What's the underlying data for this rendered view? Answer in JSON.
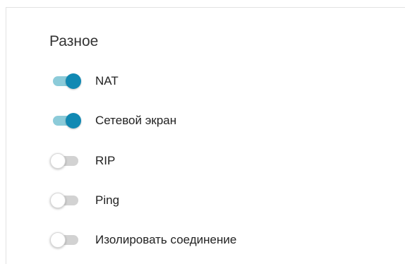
{
  "section": {
    "title": "Разное"
  },
  "toggles": [
    {
      "label": "NAT",
      "state": "on"
    },
    {
      "label": "Сетевой экран",
      "state": "on"
    },
    {
      "label": "RIP",
      "state": "off"
    },
    {
      "label": "Ping",
      "state": "off"
    },
    {
      "label": "Изолировать соединение",
      "state": "off"
    }
  ],
  "colors": {
    "knob_on": "#1189b3",
    "track_on": "#8ccbd9",
    "track_off": "#d2d2d2",
    "knob_off": "#ffffff"
  }
}
